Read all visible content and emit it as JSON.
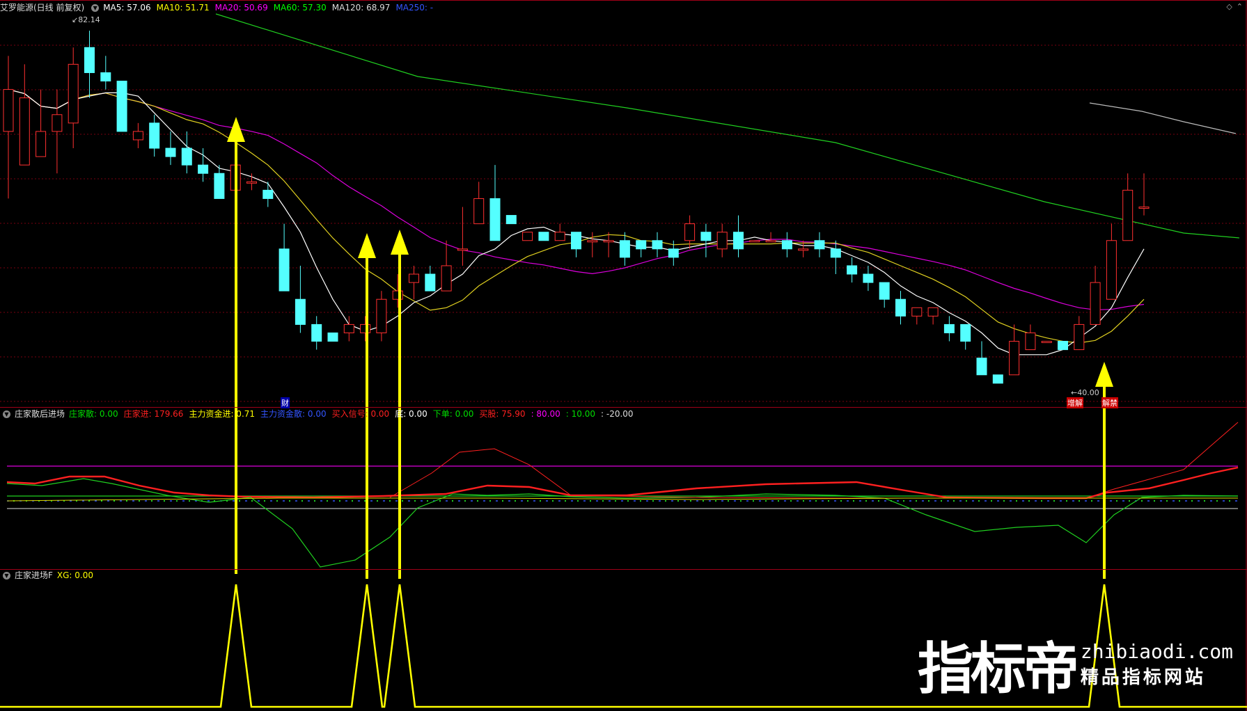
{
  "main_panel": {
    "title": "艾罗能源(日线 前复权)",
    "ma_labels": [
      {
        "text": "MA5: 57.06",
        "color": "#ffffff"
      },
      {
        "text": "MA10: 51.71",
        "color": "#ffff00"
      },
      {
        "text": "MA20: 50.69",
        "color": "#ff00ff"
      },
      {
        "text": "MA60: 57.30",
        "color": "#00ff00"
      },
      {
        "text": "MA120: 68.97",
        "color": "#dddddd"
      },
      {
        "text": "MA250: -",
        "color": "#3355ff"
      }
    ],
    "high_label": "82.14",
    "low_label": "40.00",
    "marker_cai": "财",
    "marker_zengjian": "增解",
    "marker_jiejin": "解禁"
  },
  "sub_panel_1": {
    "title": "庄家散后进场",
    "fields": [
      {
        "text": "庄家散: 0.00",
        "color": "#00dd00"
      },
      {
        "text": "庄家进: 179.66",
        "color": "#ff2020"
      },
      {
        "text": "主力资金进: 0.71",
        "color": "#ffff00"
      },
      {
        "text": "主力资金散: 0.00",
        "color": "#3355ff"
      },
      {
        "text": "买入信号: 0.00",
        "color": "#ff2020"
      },
      {
        "text": "底: 0.00",
        "color": "#ffffff"
      },
      {
        "text": "下单: 0.00",
        "color": "#00dd00"
      },
      {
        "text": "买股: 75.90",
        "color": "#ff2020"
      },
      {
        "text": ": 80.00",
        "color": "#ff00ff"
      },
      {
        "text": ": 10.00",
        "color": "#00dd00"
      },
      {
        "text": ": -20.00",
        "color": "#dddddd"
      }
    ]
  },
  "sub_panel_2": {
    "title": "庄家进场F",
    "fields": [
      {
        "text": "XG: 0.00",
        "color": "#ffff00"
      }
    ]
  },
  "watermark": {
    "brand": "指标帝",
    "url": "zhibiaodi.com",
    "slogan": "精品指标网站"
  },
  "icons": [
    "diamond-icon",
    "collapse-icon"
  ],
  "colors": {
    "up": "#ff3030",
    "down": "#54ffff",
    "grid": "#7a0010",
    "arrow": "#ffff00"
  },
  "chart_data": {
    "type": "candlestick",
    "candles": [
      [
        70,
        75,
        62,
        79
      ],
      [
        66,
        74,
        66,
        78
      ],
      [
        67,
        70,
        67,
        75
      ],
      [
        70,
        72,
        65,
        75
      ],
      [
        71,
        78,
        68,
        80
      ],
      [
        80,
        77,
        74,
        82
      ],
      [
        77,
        76,
        75,
        79
      ],
      [
        76,
        70,
        70,
        76
      ],
      [
        69,
        70,
        68,
        71
      ],
      [
        71,
        68,
        67,
        72
      ],
      [
        68,
        67,
        66,
        70
      ],
      [
        68,
        66,
        65,
        70
      ],
      [
        66,
        65,
        64,
        68
      ],
      [
        65,
        62,
        62,
        66
      ],
      [
        63,
        66,
        62,
        68
      ],
      [
        64,
        64,
        63,
        65
      ],
      [
        63,
        62,
        61,
        64
      ],
      [
        56,
        51,
        51,
        59
      ],
      [
        50,
        47,
        46,
        54
      ],
      [
        47,
        45,
        44,
        48
      ],
      [
        46,
        45,
        45,
        46
      ],
      [
        46,
        47,
        45,
        48
      ],
      [
        46,
        47,
        45,
        48
      ],
      [
        46,
        50,
        45,
        51
      ],
      [
        50,
        51,
        49,
        53
      ],
      [
        52,
        53,
        50,
        54
      ],
      [
        53,
        51,
        51,
        54
      ],
      [
        51,
        54,
        51,
        57
      ],
      [
        56,
        56,
        54,
        61
      ],
      [
        59,
        62,
        59,
        64
      ],
      [
        62,
        57,
        57,
        66
      ],
      [
        60,
        59,
        59,
        60
      ],
      [
        57,
        58,
        57,
        58
      ],
      [
        58,
        57,
        57,
        58
      ],
      [
        57,
        58,
        57,
        59
      ],
      [
        58,
        56,
        55,
        58
      ],
      [
        57,
        57,
        55,
        58
      ],
      [
        57,
        57,
        55,
        58
      ],
      [
        57,
        55,
        54,
        58
      ],
      [
        57,
        56,
        55,
        57
      ],
      [
        57,
        56,
        55,
        58
      ],
      [
        56,
        55,
        54,
        57
      ],
      [
        57,
        59,
        56,
        60
      ],
      [
        58,
        57,
        55,
        59
      ],
      [
        56,
        58,
        55,
        59
      ],
      [
        58,
        56,
        55,
        60
      ],
      [
        57,
        57,
        57,
        57
      ],
      [
        57,
        57,
        57,
        58
      ],
      [
        57,
        56,
        55,
        58
      ],
      [
        56,
        56,
        55,
        57
      ],
      [
        57,
        56,
        55,
        58
      ],
      [
        56,
        55,
        53,
        57
      ],
      [
        54,
        53,
        52,
        55
      ],
      [
        53,
        52,
        51,
        54
      ],
      [
        52,
        50,
        49,
        52
      ],
      [
        50,
        48,
        47,
        51
      ],
      [
        48,
        49,
        47,
        49
      ],
      [
        48,
        49,
        47,
        49
      ],
      [
        47,
        46,
        45,
        48
      ],
      [
        47,
        45,
        44,
        47
      ],
      [
        43,
        41,
        41,
        45
      ],
      [
        41,
        40,
        40,
        41
      ],
      [
        41,
        45,
        41,
        47
      ],
      [
        44,
        46,
        44,
        47
      ],
      [
        45,
        45,
        45,
        45
      ],
      [
        45,
        44,
        44,
        45
      ],
      [
        44,
        47,
        44,
        48
      ],
      [
        47,
        52,
        47,
        54
      ],
      [
        50,
        57,
        50,
        59
      ],
      [
        57,
        63,
        57,
        65
      ],
      [
        61,
        61,
        60,
        65
      ]
    ]
  }
}
